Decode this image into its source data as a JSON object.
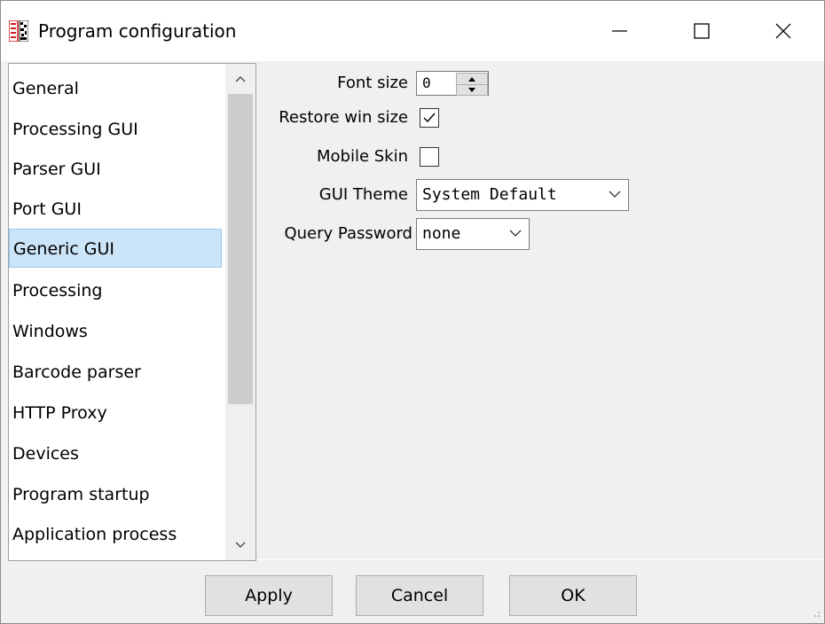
{
  "window": {
    "title": "Program configuration",
    "icon": "scan-app-icon",
    "controls": {
      "minimize": "–",
      "maximize": "□",
      "close": "✕"
    }
  },
  "nav": {
    "selected_index": 4,
    "items": [
      {
        "label": "General"
      },
      {
        "label": "Processing GUI"
      },
      {
        "label": "Parser GUI"
      },
      {
        "label": "Port GUI"
      },
      {
        "label": "Generic GUI"
      },
      {
        "label": "Processing"
      },
      {
        "label": "Windows"
      },
      {
        "label": "Barcode parser"
      },
      {
        "label": "HTTP Proxy"
      },
      {
        "label": "Devices"
      },
      {
        "label": "Program startup"
      },
      {
        "label": "Application process"
      }
    ]
  },
  "settings": {
    "font_size_label": "Font size",
    "font_size_value": "0",
    "restore_win_size_label": "Restore win size",
    "restore_win_size_checked": true,
    "mobile_skin_label": "Mobile Skin",
    "mobile_skin_checked": false,
    "gui_theme_label": "GUI Theme",
    "gui_theme_value": "System Default",
    "query_password_label": "Query Password",
    "query_password_value": "none"
  },
  "footer": {
    "apply_label": "Apply",
    "cancel_label": "Cancel",
    "ok_label": "OK"
  },
  "colors": {
    "selection_bg": "#cce4f7",
    "selection_border": "#99c9ef",
    "icon_red": "#d21f1f"
  }
}
